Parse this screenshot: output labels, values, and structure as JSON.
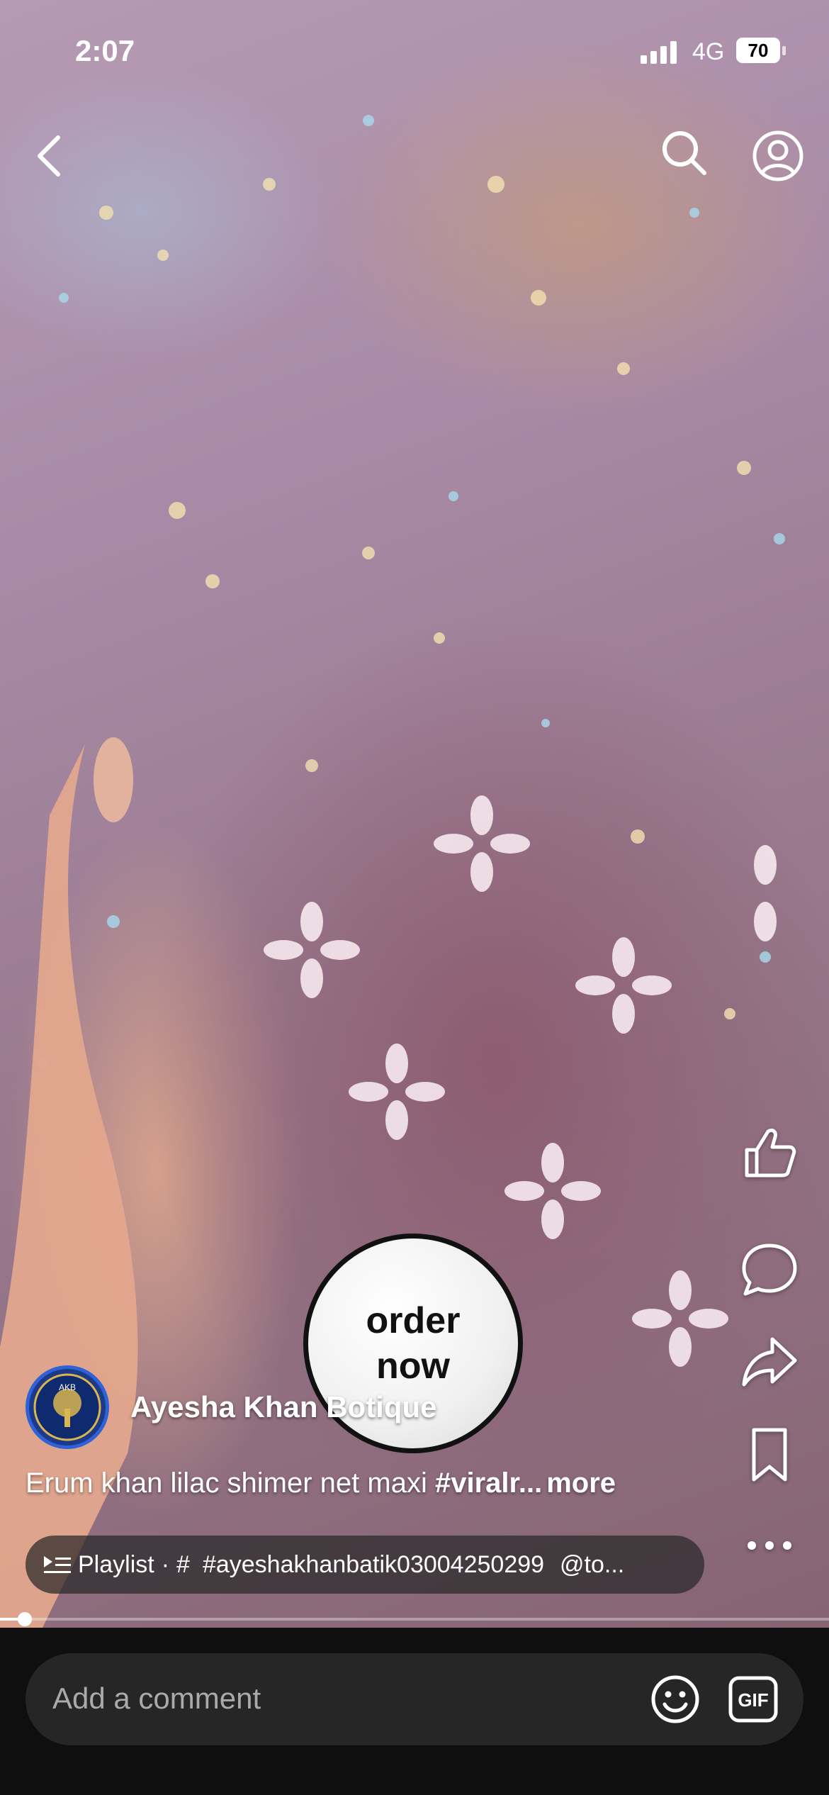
{
  "status_bar": {
    "time": "2:07",
    "network": "4G",
    "battery": "70"
  },
  "top_nav": {
    "back_icon": "back-arrow-icon",
    "search_icon": "search-icon",
    "account_icon": "account-icon"
  },
  "side_actions": {
    "like_icon": "thumbs-up-icon",
    "comment_icon": "comment-icon",
    "share_icon": "share-icon",
    "save_icon": "bookmark-icon",
    "more_icon": "more-dots-icon"
  },
  "sticker": {
    "line1": "order",
    "line2": "now"
  },
  "channel": {
    "name": "Ayesha Khan Botique",
    "avatar_text": "AKB"
  },
  "caption": {
    "text": "Erum khan lilac shimer net maxi ",
    "hashtag": "#viralr...",
    "more": "more"
  },
  "playlist": {
    "label": "Playlist",
    "hash": "#",
    "tag": "#ayeshakhanbatik03004250299",
    "mention": "@to..."
  },
  "progress": {
    "fraction": 0.03
  },
  "comment": {
    "placeholder": "Add a comment",
    "gif_label": "GIF"
  },
  "colors": {
    "accent": "#ffffff",
    "bottom_bar": "#0f0f0f",
    "comment_box": "#262626"
  }
}
